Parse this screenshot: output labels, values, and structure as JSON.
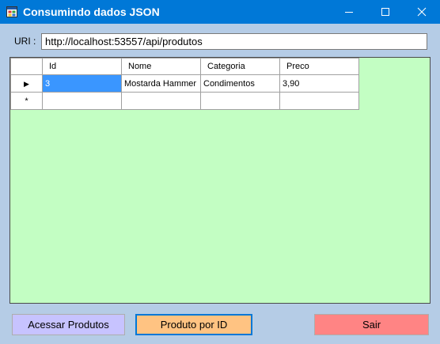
{
  "window": {
    "title": "Consumindo dados JSON",
    "icon": "winforms-app-icon",
    "controls": {
      "minimize": "minimize-icon",
      "maximize": "maximize-icon",
      "close": "close-icon"
    }
  },
  "uri": {
    "label": "URI :",
    "value": "http://localhost:53557/api/produtos"
  },
  "grid": {
    "columns": [
      "Id",
      "Nome",
      "Categoria",
      "Preco"
    ],
    "rows": [
      {
        "Id": "3",
        "Nome": "Mostarda Hammer",
        "Categoria": "Condimentos",
        "Preco": "3,90"
      }
    ],
    "current_row_marker": "▶",
    "new_row_marker": "*",
    "background_color": "#c3fec3",
    "selection_color": "#3a96ff"
  },
  "buttons": {
    "acessar": "Acessar Produtos",
    "produto_id": "Produto por ID",
    "sair": "Sair"
  },
  "colors": {
    "titlebar": "#0078d7",
    "form_bg": "#b5cce6",
    "acessar_btn": "#c7c3ff",
    "produto_btn": "#ffc382",
    "sair_btn": "#ff8484"
  }
}
